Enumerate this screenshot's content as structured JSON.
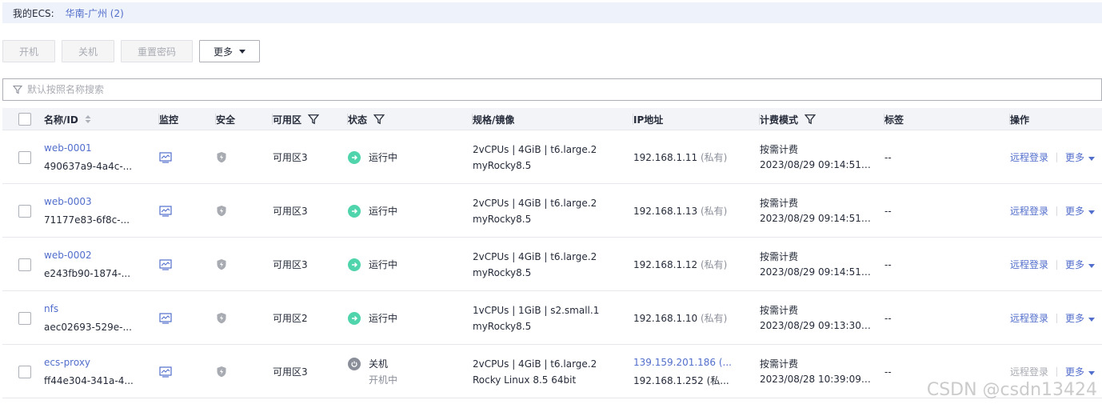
{
  "region": {
    "label": "我的ECS:",
    "value": "华南-广州 (2)"
  },
  "toolbar": {
    "start": "开机",
    "stop": "关机",
    "reset_password": "重置密码",
    "more": "更多"
  },
  "search": {
    "placeholder": "默认按照名称搜索"
  },
  "table": {
    "headers": {
      "name": "名称/ID",
      "monitor": "监控",
      "security": "安全",
      "az": "可用区",
      "status": "状态",
      "spec": "规格/镜像",
      "ip": "IP地址",
      "billing": "计费模式",
      "tags": "标签",
      "ops": "操作"
    },
    "rows": [
      {
        "name": "web-0001",
        "id": "490637a9-4a4c-...",
        "az": "可用区3",
        "status": "运行中",
        "status_sub": "",
        "spec": "2vCPUs | 4GiB | t6.large.2",
        "image": "myRocky8.5",
        "ip1": "192.168.1.11",
        "ip1_tag": "(私有)",
        "ip2": "",
        "billing": "按需计费",
        "created": "2023/08/29 09:14:51 G...",
        "tags": "--",
        "remote": "远程登录",
        "more": "更多"
      },
      {
        "name": "web-0003",
        "id": "71177e83-6f8c-...",
        "az": "可用区3",
        "status": "运行中",
        "status_sub": "",
        "spec": "2vCPUs | 4GiB | t6.large.2",
        "image": "myRocky8.5",
        "ip1": "192.168.1.13",
        "ip1_tag": "(私有)",
        "ip2": "",
        "billing": "按需计费",
        "created": "2023/08/29 09:14:51 G...",
        "tags": "--",
        "remote": "远程登录",
        "more": "更多"
      },
      {
        "name": "web-0002",
        "id": "e243fb90-1874-...",
        "az": "可用区3",
        "status": "运行中",
        "status_sub": "",
        "spec": "2vCPUs | 4GiB | t6.large.2",
        "image": "myRocky8.5",
        "ip1": "192.168.1.12",
        "ip1_tag": "(私有)",
        "ip2": "",
        "billing": "按需计费",
        "created": "2023/08/29 09:14:51 G...",
        "tags": "--",
        "remote": "远程登录",
        "more": "更多"
      },
      {
        "name": "nfs",
        "id": "aec02693-529e-...",
        "az": "可用区2",
        "status": "运行中",
        "status_sub": "",
        "spec": "1vCPUs | 1GiB | s2.small.1",
        "image": "myRocky8.5",
        "ip1": "192.168.1.10",
        "ip1_tag": "(私有)",
        "ip2": "",
        "billing": "按需计费",
        "created": "2023/08/29 09:13:30 G...",
        "tags": "--",
        "remote": "远程登录",
        "more": "更多"
      },
      {
        "name": "ecs-proxy",
        "id": "ff44e304-341a-4...",
        "az": "可用区3",
        "status": "关机",
        "status_sub": "开机中",
        "spec": "2vCPUs | 4GiB | t6.large.2",
        "image": "Rocky Linux 8.5 64bit",
        "ip1": "139.159.201.186 (...",
        "ip1_tag": "",
        "ip2": "192.168.1.252 (私...",
        "billing": "按需计费",
        "created": "2023/08/28 10:39:09 G...",
        "tags": "--",
        "remote": "远程登录",
        "more": "更多"
      }
    ]
  },
  "watermark": "CSDN @csdn13424",
  "colors": {
    "link": "#526ecc",
    "running": "#50d4ab",
    "stopped": "#8a8e99",
    "header_bg": "#f3f4f7"
  }
}
